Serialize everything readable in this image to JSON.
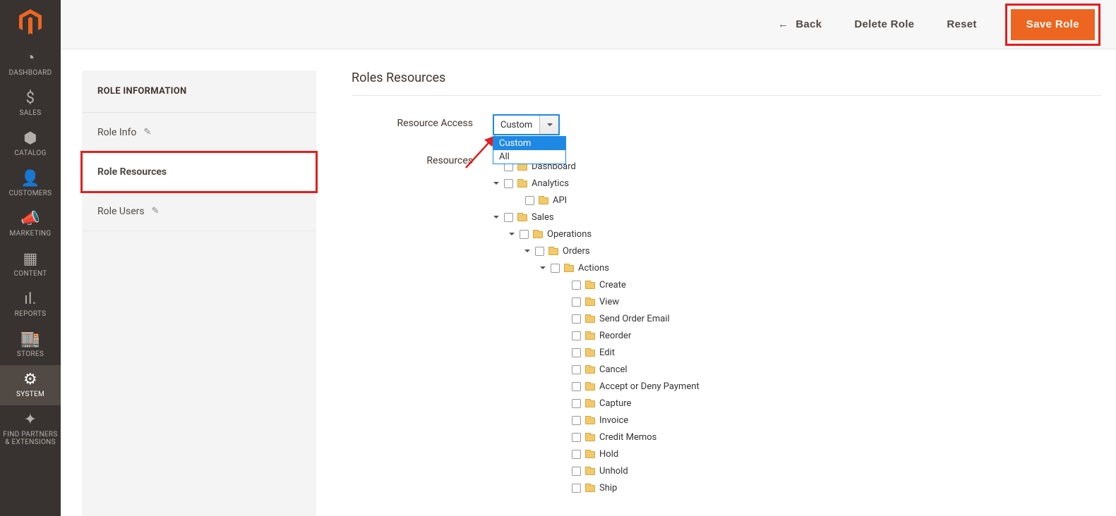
{
  "nav": {
    "items": [
      {
        "label": "DASHBOARD",
        "icon": "◔"
      },
      {
        "label": "SALES",
        "icon": "$"
      },
      {
        "label": "CATALOG",
        "icon": "⬢"
      },
      {
        "label": "CUSTOMERS",
        "icon": "👤"
      },
      {
        "label": "MARKETING",
        "icon": "📣"
      },
      {
        "label": "CONTENT",
        "icon": "▦"
      },
      {
        "label": "REPORTS",
        "icon": "ıl."
      },
      {
        "label": "STORES",
        "icon": "🏬"
      },
      {
        "label": "SYSTEM",
        "icon": "⚙"
      },
      {
        "label": "FIND PARTNERS & EXTENSIONS",
        "icon": "✦"
      }
    ],
    "activeIndex": 8
  },
  "topbar": {
    "back": "Back",
    "delete": "Delete Role",
    "reset": "Reset",
    "save": "Save Role"
  },
  "sidepanel": {
    "title": "ROLE INFORMATION",
    "items": [
      {
        "label": "Role Info",
        "edit": true
      },
      {
        "label": "Role Resources",
        "edit": false
      },
      {
        "label": "Role Users",
        "edit": true
      }
    ],
    "activeIndex": 1
  },
  "section": {
    "title": "Roles Resources",
    "resourceAccess": {
      "label": "Resource Access",
      "value": "Custom",
      "options": [
        "Custom",
        "All"
      ]
    },
    "resourcesLabel": "Resources"
  },
  "tree": [
    {
      "label": "Dashboard",
      "leaf": true
    },
    {
      "label": "Analytics",
      "expanded": true,
      "children": [
        {
          "label": "API",
          "leaf": true
        }
      ]
    },
    {
      "label": "Sales",
      "expanded": true,
      "children": [
        {
          "label": "Operations",
          "expanded": true,
          "children": [
            {
              "label": "Orders",
              "expanded": true,
              "children": [
                {
                  "label": "Actions",
                  "expanded": true,
                  "children": [
                    {
                      "label": "Create",
                      "leaf": true
                    },
                    {
                      "label": "View",
                      "leaf": true
                    },
                    {
                      "label": "Send Order Email",
                      "leaf": true
                    },
                    {
                      "label": "Reorder",
                      "leaf": true
                    },
                    {
                      "label": "Edit",
                      "leaf": true
                    },
                    {
                      "label": "Cancel",
                      "leaf": true
                    },
                    {
                      "label": "Accept or Deny Payment",
                      "leaf": true
                    },
                    {
                      "label": "Capture",
                      "leaf": true
                    },
                    {
                      "label": "Invoice",
                      "leaf": true
                    },
                    {
                      "label": "Credit Memos",
                      "leaf": true
                    },
                    {
                      "label": "Hold",
                      "leaf": true
                    },
                    {
                      "label": "Unhold",
                      "leaf": true
                    },
                    {
                      "label": "Ship",
                      "leaf": true
                    }
                  ]
                }
              ]
            }
          ]
        }
      ]
    }
  ]
}
